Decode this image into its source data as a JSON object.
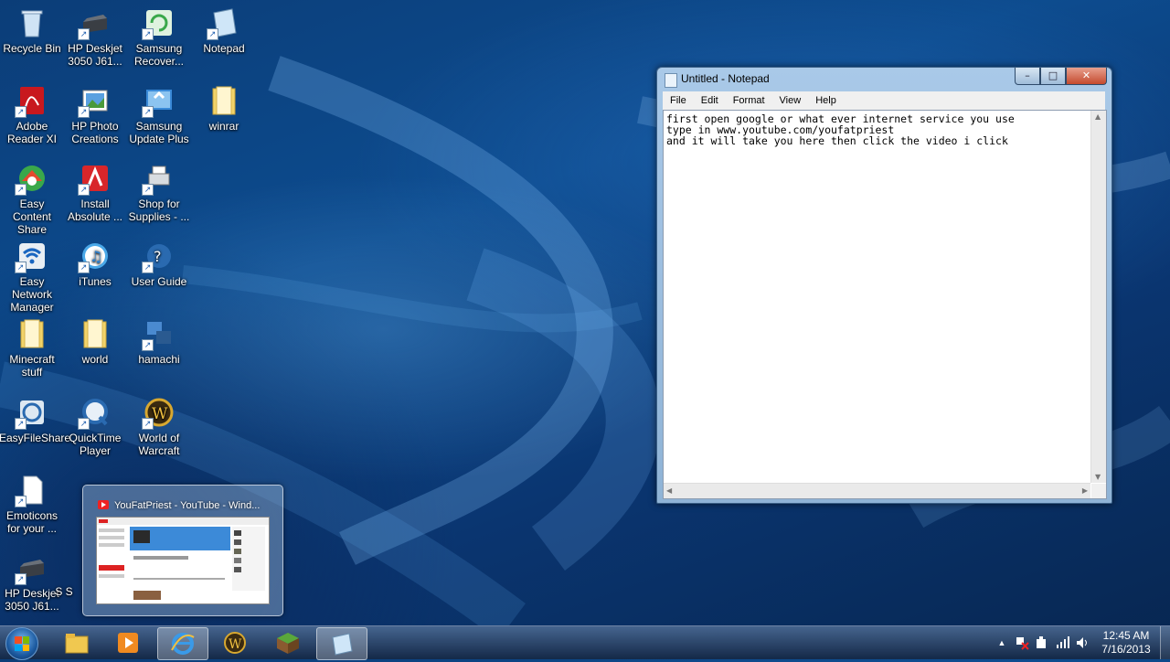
{
  "desktop": {
    "icons": [
      {
        "label": "Recycle Bin",
        "icon": "recycle-bin-icon",
        "shortcut": false
      },
      {
        "label": "HP Deskjet 3050 J61...",
        "icon": "printer-icon",
        "shortcut": true
      },
      {
        "label": "Samsung Recover...",
        "icon": "recovery-icon",
        "shortcut": true
      },
      {
        "label": "Notepad",
        "icon": "notepad-icon",
        "shortcut": true
      },
      {
        "label": "Adobe Reader XI",
        "icon": "adobe-reader-icon",
        "shortcut": true
      },
      {
        "label": "HP Photo Creations",
        "icon": "photo-icon",
        "shortcut": true
      },
      {
        "label": "Samsung Update Plus",
        "icon": "update-icon",
        "shortcut": true
      },
      {
        "label": "winrar",
        "icon": "folder-icon",
        "shortcut": false
      },
      {
        "label": "Easy Content Share",
        "icon": "content-share-icon",
        "shortcut": true
      },
      {
        "label": "Install Absolute ...",
        "icon": "install-icon",
        "shortcut": true
      },
      {
        "label": "Shop for Supplies - ...",
        "icon": "printer-supplies-icon",
        "shortcut": true
      },
      {
        "label": "Easy Network Manager",
        "icon": "network-icon",
        "shortcut": true
      },
      {
        "label": "iTunes",
        "icon": "itunes-icon",
        "shortcut": true
      },
      {
        "label": "User Guide",
        "icon": "help-icon",
        "shortcut": true
      },
      {
        "label": "Minecraft stuff",
        "icon": "folder-icon",
        "shortcut": false
      },
      {
        "label": "world",
        "icon": "folder-icon",
        "shortcut": false
      },
      {
        "label": "hamachi",
        "icon": "hamachi-icon",
        "shortcut": true
      },
      {
        "label": "EasyFileShare",
        "icon": "file-share-icon",
        "shortcut": true
      },
      {
        "label": "QuickTime Player",
        "icon": "quicktime-icon",
        "shortcut": true
      },
      {
        "label": "World of Warcraft",
        "icon": "warcraft-icon",
        "shortcut": true
      },
      {
        "label": "Emoticons for your ...",
        "icon": "document-icon",
        "shortcut": true
      },
      {
        "label": "HP Deskjet 3050 J61...",
        "icon": "printer-icon",
        "shortcut": true
      },
      {
        "label": "S S",
        "icon": "partial-icon",
        "shortcut": false
      }
    ]
  },
  "notepad": {
    "title": "Untitled - Notepad",
    "menu": [
      "File",
      "Edit",
      "Format",
      "View",
      "Help"
    ],
    "content": "first open google or what ever internet service you use\ntype in www.youtube.com/youfatpriest\nand it will take you here then click the video i click",
    "buttons": {
      "minimize": "–",
      "maximize": "□",
      "close": "✕"
    }
  },
  "thumbnail": {
    "title": "YouFatPriest - YouTube - Wind..."
  },
  "taskbar": {
    "items": [
      {
        "name": "explorer-icon",
        "active": false
      },
      {
        "name": "media-player-icon",
        "active": false
      },
      {
        "name": "internet-explorer-icon",
        "active": true
      },
      {
        "name": "warcraft-icon",
        "active": false
      },
      {
        "name": "minecraft-icon",
        "active": false
      },
      {
        "name": "notepad-icon",
        "active": true
      }
    ],
    "tray": {
      "show_hidden": "▲",
      "time": "12:45 AM",
      "date": "7/16/2013"
    }
  },
  "colors": {
    "desktop": "#0d4c8f",
    "close_button": "#c44a2e"
  }
}
